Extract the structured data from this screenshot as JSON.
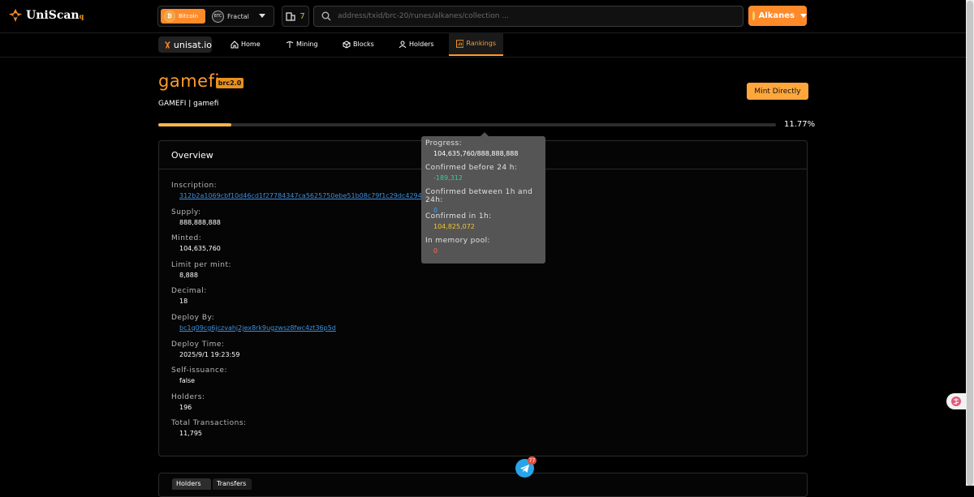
{
  "brand": {
    "name": "UniScan",
    "suffix": "q"
  },
  "network": {
    "btc_label": "Bitcoin",
    "fractal_label": "Fractal",
    "fractal_coin_text": "BTC"
  },
  "blocks": {
    "count": "7"
  },
  "search": {
    "placeholder": "address/txid/brc-20/runes/alkanes/collection ..."
  },
  "alkanes": {
    "label": "Alkanes"
  },
  "nav": {
    "unisat_label": "unisat.io",
    "items": [
      {
        "label": "Home",
        "icon": "home-icon"
      },
      {
        "label": "Mining",
        "icon": "pickaxe-icon"
      },
      {
        "label": "Blocks",
        "icon": "cube-icon"
      },
      {
        "label": "Holders",
        "icon": "user-icon"
      },
      {
        "label": "Rankings",
        "icon": "rankings-icon",
        "active": true
      }
    ]
  },
  "token": {
    "name": "gamefi",
    "badge": "brc2.0",
    "subtitle": "GAMEFI | gamefi",
    "mint_label": "Mint Directly",
    "progress_fraction": 0.1177,
    "progress_text": "11.77%"
  },
  "overview": {
    "title": "Overview",
    "fields": [
      {
        "label": "Inscription:",
        "value": "312b2a1069cbf10d46cd1f27784347ca5625750ebe51b08c79f1c29dc4294",
        "link": true
      },
      {
        "label": "Supply:",
        "value": "888,888,888"
      },
      {
        "label": "Minted:",
        "value": "104,635,760"
      },
      {
        "label": "Limit per mint:",
        "value": "8,888"
      },
      {
        "label": "Decimal:",
        "value": "18"
      },
      {
        "label": "Deploy By:",
        "value": "bc1q09cg6jczvahj2jex8rk9ugzwsz8fwc4zt36p5d",
        "link": true
      },
      {
        "label": "Deploy Time:",
        "value": "2025/9/1 19:23:59"
      },
      {
        "label": "Self-issuance:",
        "value": "false"
      },
      {
        "label": "Holders:",
        "value": "196"
      },
      {
        "label": "Total Transactions:",
        "value": "11,795"
      }
    ]
  },
  "tooltip": {
    "rows": [
      {
        "label": "Progress:",
        "value": "104,635,760/888,888,888",
        "color": "#ffffff"
      },
      {
        "label": "Confirmed before 24 h:",
        "value": "-189,312",
        "color": "#27d3a0"
      },
      {
        "label": "Confirmed between 1h and 24h:",
        "value": "0",
        "color": "#3ea0ff"
      },
      {
        "label": "Confirmed in 1h:",
        "value": "104,825,072",
        "color": "#f4c430"
      },
      {
        "label": "In memory pool:",
        "value": "0",
        "color": "#ff6a4d"
      }
    ]
  },
  "lower_tabs": [
    "Holders",
    "Transfers"
  ],
  "telegram": {
    "badge": "77"
  }
}
